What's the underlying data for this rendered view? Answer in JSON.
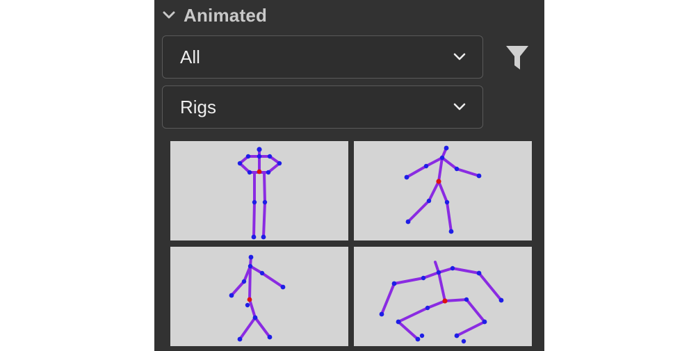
{
  "section": {
    "title": "Animated",
    "icon": "chevron-down-icon"
  },
  "dropdowns": {
    "category": {
      "value": "All",
      "icon": "chevron-down-icon"
    },
    "type": {
      "value": "Rigs",
      "icon": "chevron-down-icon"
    }
  },
  "filter": {
    "icon": "filter-funnel-icon"
  },
  "thumbnails": [
    {
      "pose": "hands-on-hips"
    },
    {
      "pose": "walking"
    },
    {
      "pose": "dancing"
    },
    {
      "pose": "crawling"
    }
  ],
  "colors": {
    "panel": "#323232",
    "text": "#ededed",
    "header_text": "#c8c8c8",
    "thumb_bg": "#d4d4d4",
    "bone": "#8a2be2",
    "joint": "#1e1ee6",
    "root_joint": "#dd1111"
  }
}
